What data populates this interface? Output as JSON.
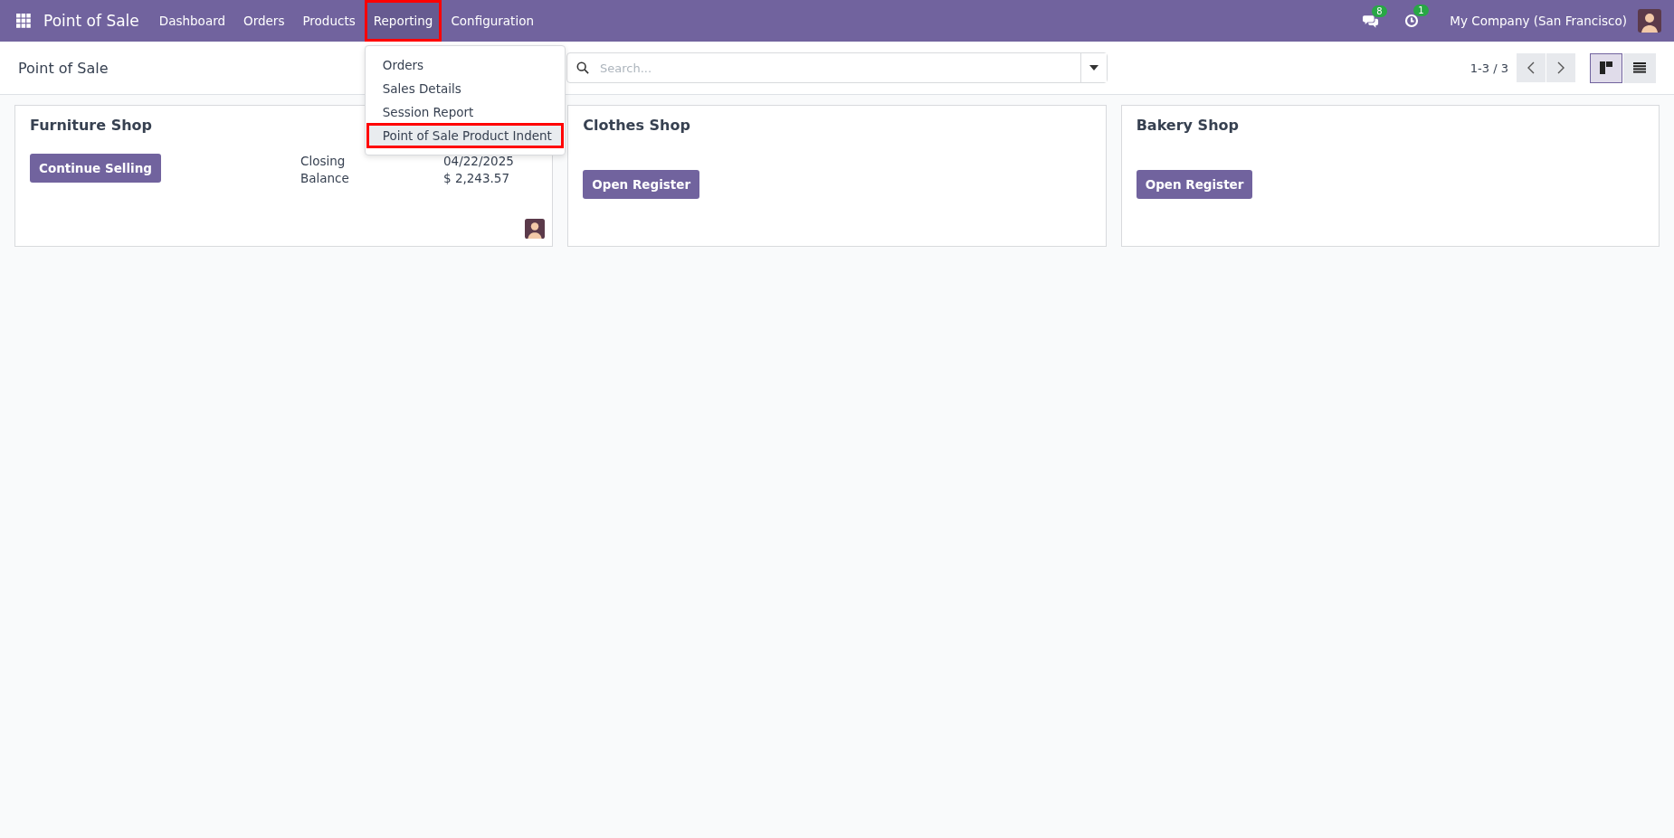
{
  "navbar": {
    "app_name": "Point of Sale",
    "menu": [
      {
        "label": "Dashboard",
        "selected": false,
        "highlighted": false
      },
      {
        "label": "Orders",
        "selected": false,
        "highlighted": false
      },
      {
        "label": "Products",
        "selected": false,
        "highlighted": false
      },
      {
        "label": "Reporting",
        "selected": true,
        "highlighted": true
      },
      {
        "label": "Configuration",
        "selected": false,
        "highlighted": false
      }
    ],
    "dropdown": [
      {
        "label": "Orders",
        "selected": false,
        "highlighted": false
      },
      {
        "label": "Sales Details",
        "selected": false,
        "highlighted": false
      },
      {
        "label": "Session Report",
        "selected": false,
        "highlighted": false
      },
      {
        "label": "Point of Sale Product Indent",
        "selected": true,
        "highlighted": true
      }
    ],
    "messages_badge": "8",
    "activities_badge": "1",
    "company": "My Company (San Francisco)"
  },
  "control_panel": {
    "title": "Point of Sale",
    "search": {
      "placeholder": "Search..."
    },
    "pager": "1-3 / 3",
    "views": [
      {
        "kind": "kanban",
        "selected": true
      },
      {
        "kind": "list",
        "selected": false
      }
    ]
  },
  "cards": [
    {
      "name": "Furniture Shop",
      "button": "Continue Selling",
      "stats": [
        {
          "label": "Closing",
          "value": "04/22/2025"
        },
        {
          "label": "Balance",
          "value": "$ 2,243.57"
        }
      ],
      "avatar": true
    },
    {
      "name": "Clothes Shop",
      "button": "Open Register",
      "avatar": false
    },
    {
      "name": "Bakery Shop",
      "button": "Open Register",
      "avatar": false
    }
  ]
}
